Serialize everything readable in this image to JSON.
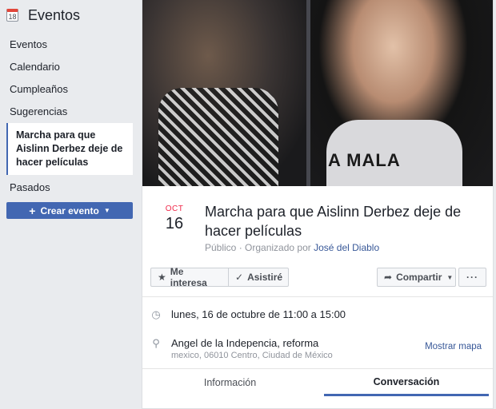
{
  "sidebar": {
    "header": {
      "icon_text": "18",
      "title": "Eventos"
    },
    "items": [
      {
        "label": "Eventos"
      },
      {
        "label": "Calendario"
      },
      {
        "label": "Cumpleaños"
      },
      {
        "label": "Sugerencias"
      },
      {
        "label": "Marcha para que Aislinn Derbez deje de hacer películas"
      },
      {
        "label": "Pasados"
      }
    ],
    "create_label": "Crear evento"
  },
  "cover": {
    "shirt_text": "A MALA"
  },
  "event": {
    "month": "OCT",
    "day": "16",
    "title": "Marcha para que Aislinn Derbez deje de hacer películas",
    "privacy": "Público",
    "organized_prefix": "· Organizado por",
    "organizer": "José del Diablo"
  },
  "actions": {
    "interest_label": "Me interesa",
    "going_label": "Asistiré",
    "share_label": "Compartir",
    "more_label": "···"
  },
  "details": {
    "time": "lunes, 16 de octubre de 11:00 a 15:00",
    "place_name": "Angel de la Indepencia, reforma",
    "place_address": "mexico, 06010 Centro, Ciudad de México",
    "map_link": "Mostrar mapa"
  },
  "tabs": [
    {
      "label": "Información",
      "active": false
    },
    {
      "label": "Conversación",
      "active": true
    }
  ],
  "colors": {
    "accent": "#4267b2",
    "link": "#385898",
    "month": "#f02849",
    "background": "#e9ebee"
  }
}
